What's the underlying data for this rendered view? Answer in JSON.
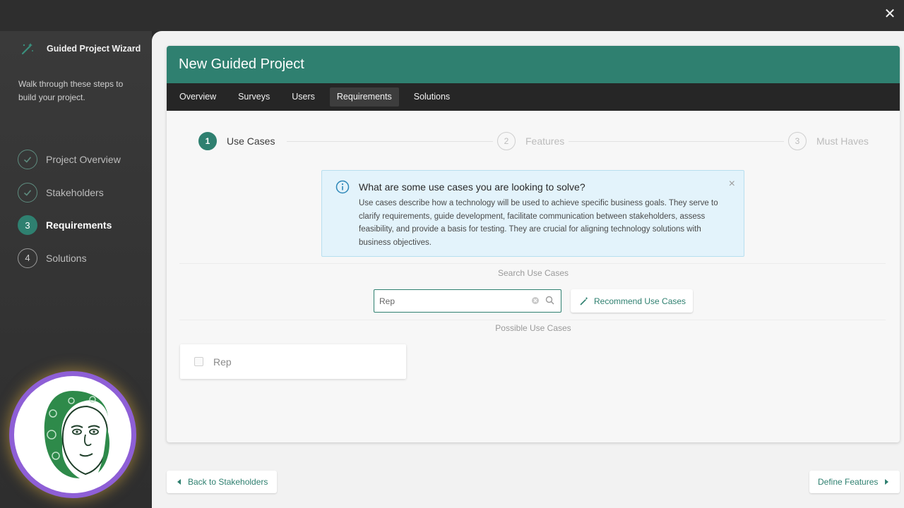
{
  "window": {
    "close_glyph": "✕"
  },
  "sidebar": {
    "title": "Guided Project Wizard",
    "title_icon": "wand-icon",
    "description": "Walk through these steps to build your project.",
    "steps": [
      {
        "label": "Project Overview",
        "status": "done",
        "marker": ""
      },
      {
        "label": "Stakeholders",
        "status": "done",
        "marker": ""
      },
      {
        "label": "Requirements",
        "status": "active",
        "marker": "3"
      },
      {
        "label": "Solutions",
        "status": "todo",
        "marker": "4"
      }
    ],
    "avatar": "illustrated-face-avatar"
  },
  "project": {
    "title": "New Guided Project",
    "tabs": [
      {
        "label": "Overview",
        "active": false
      },
      {
        "label": "Surveys",
        "active": false
      },
      {
        "label": "Users",
        "active": false
      },
      {
        "label": "Requirements",
        "active": true
      },
      {
        "label": "Solutions",
        "active": false
      }
    ]
  },
  "progress": {
    "steps": [
      {
        "number": "1",
        "label": "Use Cases",
        "active": true
      },
      {
        "number": "2",
        "label": "Features",
        "active": false
      },
      {
        "number": "3",
        "label": "Must Haves",
        "active": false
      }
    ]
  },
  "info": {
    "title": "What are some use cases you are looking to solve?",
    "body": "Use cases describe how a technology will be used to achieve specific business goals. They serve to clarify requirements, guide development, facilitate communication between stakeholders, assess feasibility, and provide a basis for testing. They are crucial for aligning technology solutions with business objectives.",
    "close_glyph": "×"
  },
  "search": {
    "label": "Search Use Cases",
    "value": "Rep",
    "recommend_label": "Recommend Use Cases"
  },
  "possible": {
    "label": "Possible Use Cases",
    "items": [
      {
        "label": "Rep",
        "checked": false
      }
    ]
  },
  "footer": {
    "back_label": "Back to Stakeholders",
    "next_label": "Define Features"
  },
  "colors": {
    "accent": "#2f8070",
    "header_bg": "#2f8070",
    "tabbar_bg": "#262626",
    "info_bg": "#e3f3fb",
    "avatar_ring": "#8e5fd6"
  }
}
